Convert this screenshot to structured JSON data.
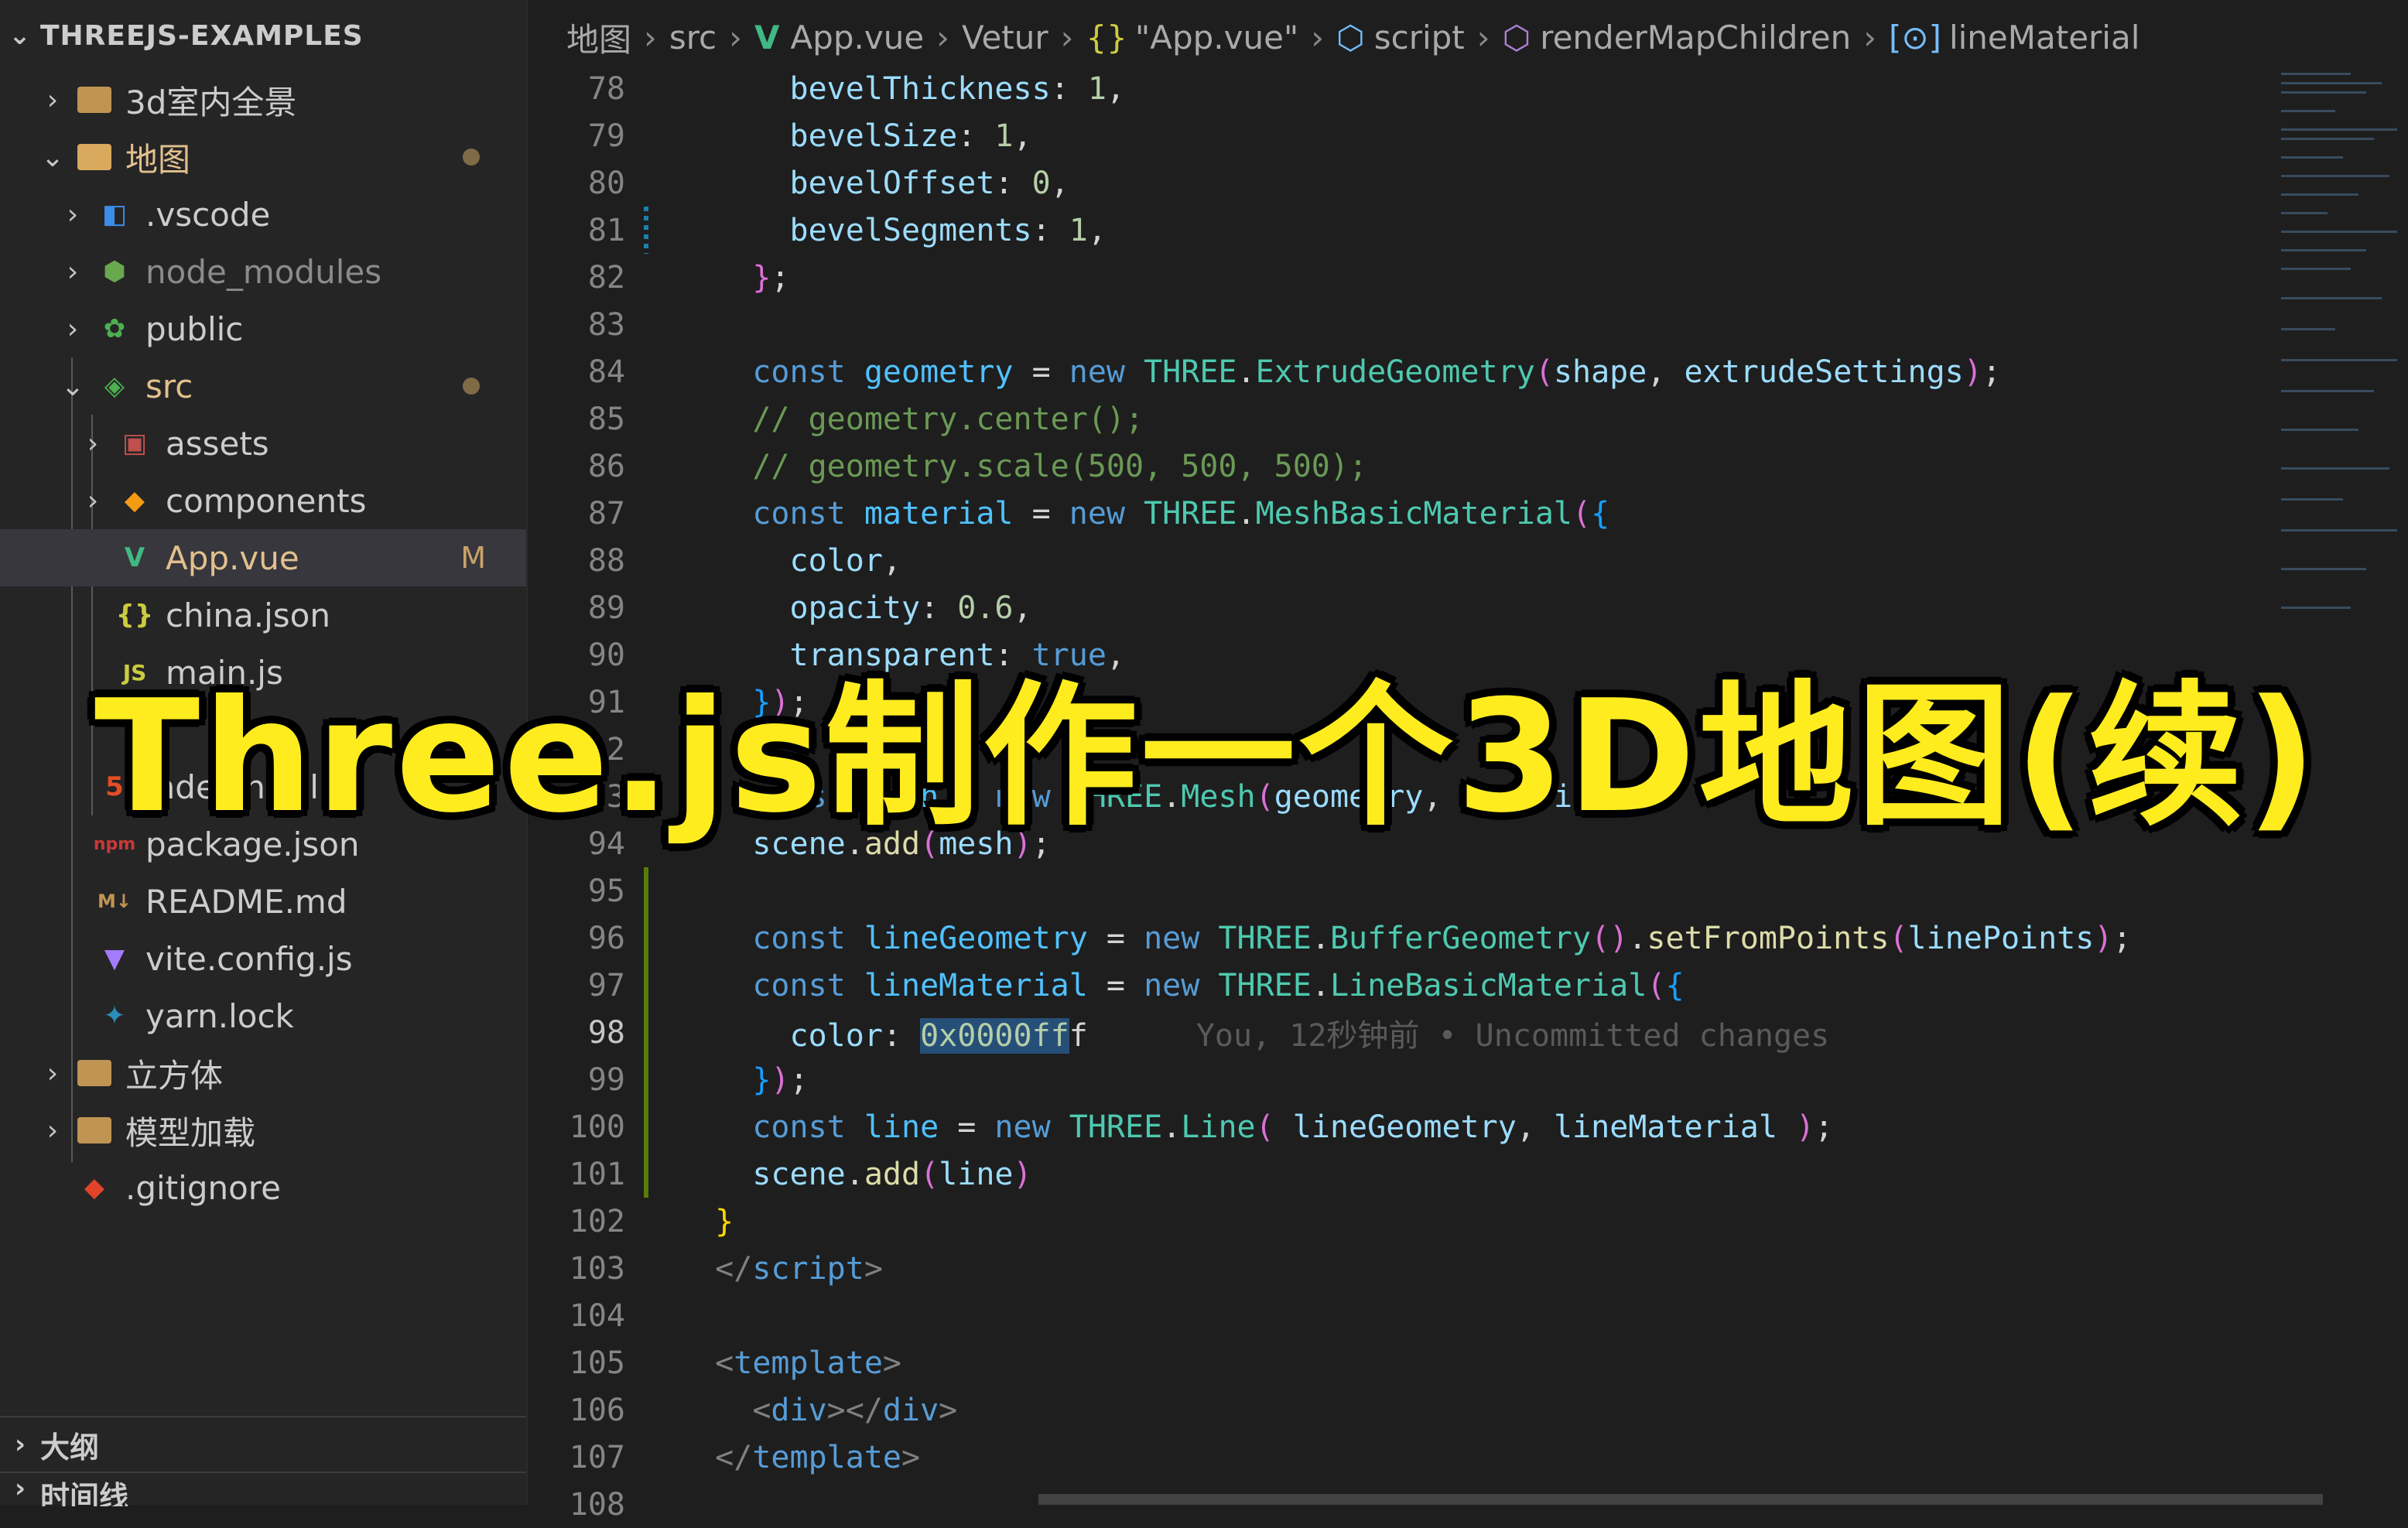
{
  "explorer": {
    "title": "THREEJS-EXAMPLES",
    "items": [
      {
        "label": "3d室内全景",
        "kind": "folder"
      },
      {
        "label": "地图",
        "kind": "folder-open"
      },
      {
        "label": ".vscode",
        "kind": "folder"
      },
      {
        "label": "node_modules",
        "kind": "folder"
      },
      {
        "label": "public",
        "kind": "folder"
      },
      {
        "label": "src",
        "kind": "folder-open"
      },
      {
        "label": "assets",
        "kind": "folder"
      },
      {
        "label": "components",
        "kind": "folder"
      },
      {
        "label": "App.vue",
        "kind": "vue",
        "badge": "M"
      },
      {
        "label": "china.json",
        "kind": "json"
      },
      {
        "label": "main.js",
        "kind": "js"
      },
      {
        "label": "index.html",
        "kind": "html"
      },
      {
        "label": "package.json",
        "kind": "npm"
      },
      {
        "label": "README.md",
        "kind": "md"
      },
      {
        "label": "vite.config.js",
        "kind": "vite"
      },
      {
        "label": "yarn.lock",
        "kind": "yarn"
      },
      {
        "label": "立方体",
        "kind": "folder"
      },
      {
        "label": "模型加载",
        "kind": "folder"
      },
      {
        "label": ".gitignore",
        "kind": "git"
      }
    ],
    "outline_label": "大纲",
    "timeline_label": "时间线"
  },
  "breadcrumb": [
    "地图",
    "src",
    "App.vue",
    "Vetur",
    "\"App.vue\"",
    "script",
    "renderMapChildren",
    "lineMaterial"
  ],
  "code": {
    "line_numbers": [
      "78",
      "79",
      "80",
      "81",
      "82",
      "83",
      "84",
      "85",
      "86",
      "87",
      "88",
      "89",
      "90",
      "91",
      "92",
      "93",
      "94",
      "95",
      "96",
      "97",
      "98",
      "99",
      "100",
      "101",
      "102",
      "103",
      "104",
      "105",
      "106",
      "107",
      "108"
    ],
    "blame": "You, 12秒钟前 • Uncommitted changes"
  },
  "banner": {
    "text": "Three.js制作一个3D地图(续)"
  },
  "colors": {
    "banner": "#ffec1f",
    "selection": "#264f78",
    "modified": "#e2c08d"
  }
}
